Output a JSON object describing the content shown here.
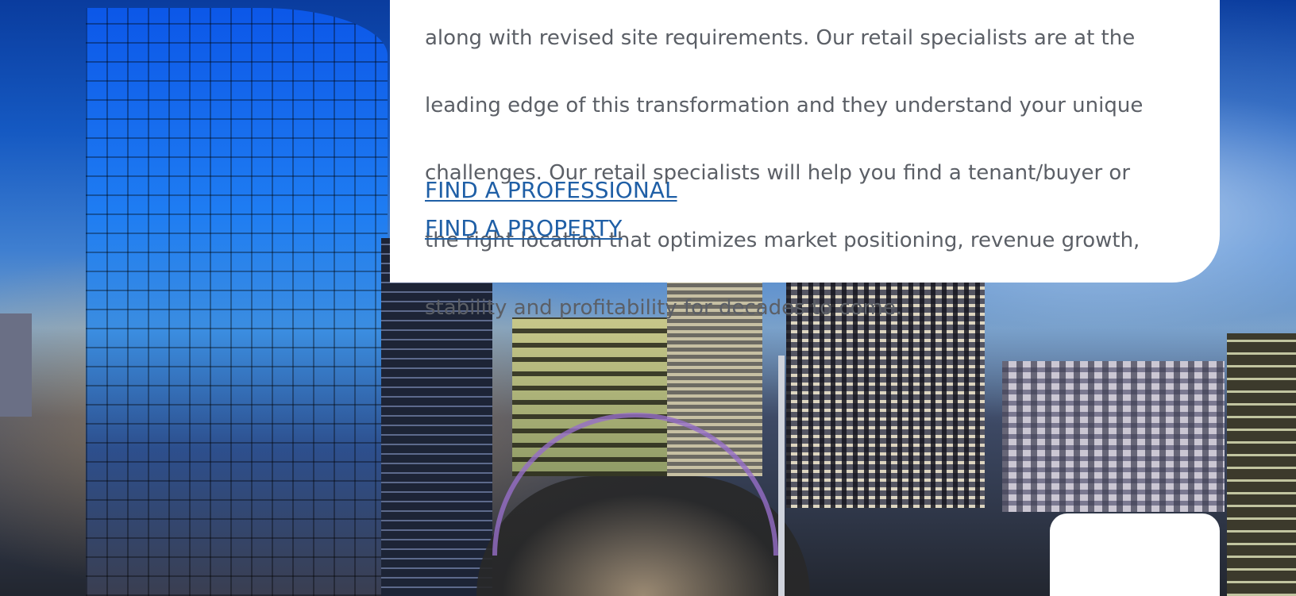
{
  "content": {
    "body_lines": [
      "along with revised site requirements. Our retail specialists are at the",
      "leading edge of this transformation and they understand your unique",
      "challenges. Our retail specialists will help you find a tenant/buyer or",
      "the right location that optimizes market positioning, revenue growth,",
      "stability and profitability for decades to come."
    ],
    "links": [
      {
        "label": "FIND A PROFESSIONAL"
      },
      {
        "label": "FIND A PROPERTY"
      }
    ]
  },
  "colors": {
    "link": "#1f5fa6",
    "body_text": "#5b5f66",
    "card": "#ffffff"
  }
}
